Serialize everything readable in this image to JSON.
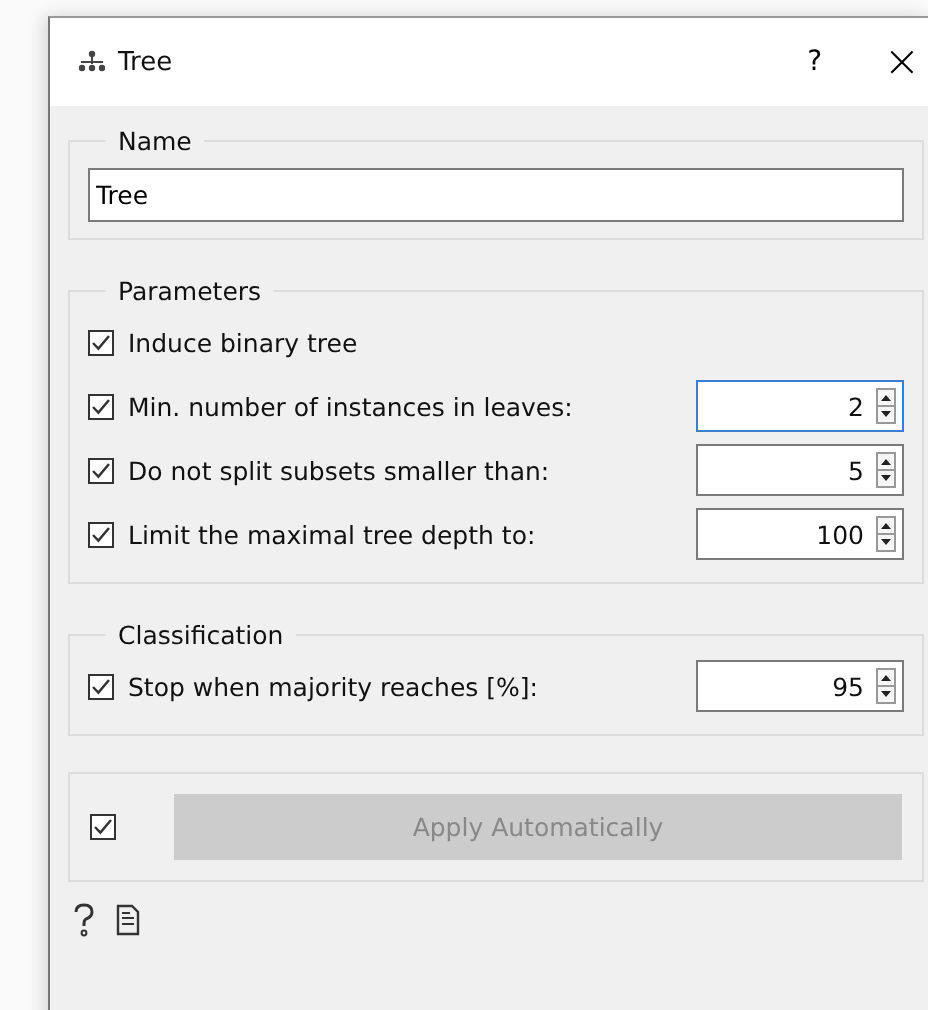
{
  "window": {
    "title": "Tree",
    "help": "?",
    "close": "×"
  },
  "name_group": {
    "title": "Name",
    "value": "Tree"
  },
  "parameters": {
    "title": "Parameters",
    "rows": [
      {
        "kind": "checkbox",
        "label": "Induce binary tree",
        "checked": true
      },
      {
        "kind": "spin",
        "label": "Min. number of instances in leaves:",
        "checked": true,
        "value": "2",
        "focused": true
      },
      {
        "kind": "spin",
        "label": "Do not split subsets smaller than:",
        "checked": true,
        "value": "5",
        "focused": false
      },
      {
        "kind": "spin",
        "label": "Limit the maximal tree depth to:",
        "checked": true,
        "value": "100",
        "focused": false
      }
    ]
  },
  "classification": {
    "title": "Classification",
    "rows": [
      {
        "kind": "spin",
        "label": "Stop when majority reaches [%]:",
        "checked": true,
        "value": "95",
        "focused": false
      }
    ]
  },
  "apply": {
    "checked": true,
    "label": "Apply Automatically",
    "disabled": true
  }
}
